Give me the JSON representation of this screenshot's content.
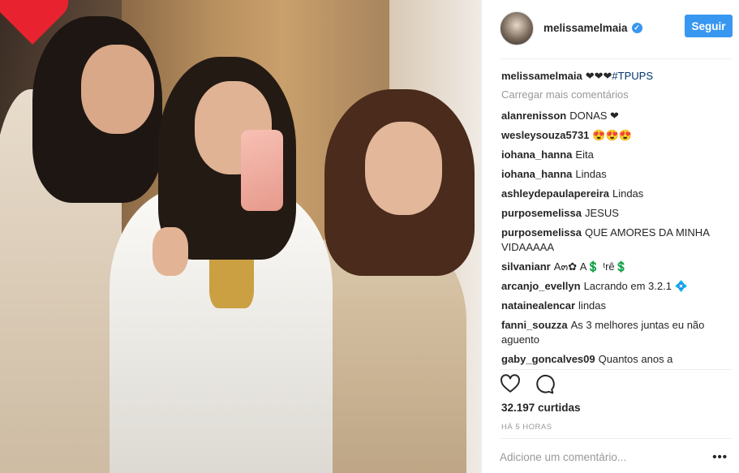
{
  "post": {
    "username": "melissamelmaia",
    "verified_icon": "verified-check-icon",
    "follow_label": "Seguir",
    "caption_user": "melissamelmaia",
    "caption_text": "❤❤❤",
    "caption_tag": "#TPUPS",
    "load_more": "Carregar mais comentários",
    "comments": [
      {
        "user": "alanrenisson",
        "text": "DONAS ❤"
      },
      {
        "user": "wesleysouza5731",
        "text": "😍😍😍"
      },
      {
        "user": "iohana_hanna",
        "text": "Eita"
      },
      {
        "user": "iohana_hanna",
        "text": "Lindas"
      },
      {
        "user": "ashleydepaulapereira",
        "text": "Lindas"
      },
      {
        "user": "purposemelissa",
        "text": "JESUS"
      },
      {
        "user": "purposemelissa",
        "text": "QUE AMORES DA MINHA VIDAAAAA"
      },
      {
        "user": "silvanianr",
        "text": "A๓✿ A💲 ᵗrê💲"
      },
      {
        "user": "arcanjo_evellyn",
        "text": "Lacrando em 3.2.1 💠"
      },
      {
        "user": "natainealencar",
        "text": "lindas"
      },
      {
        "user": "fanni_souzza",
        "text": "As 3 melhores juntas eu não aguento"
      },
      {
        "user": "gaby_goncalves09",
        "text": "Quantos anos a"
      }
    ],
    "likes": "32.197 curtidas",
    "time": "HÁ 5 HORAS",
    "add_comment_placeholder": "Adicione um comentário...",
    "more_label": "•••",
    "icons": {
      "like": "heart-icon",
      "comment": "comment-bubble-icon"
    }
  },
  "colors": {
    "accent": "#3897f0",
    "tag": "#003569",
    "muted": "#999999"
  }
}
